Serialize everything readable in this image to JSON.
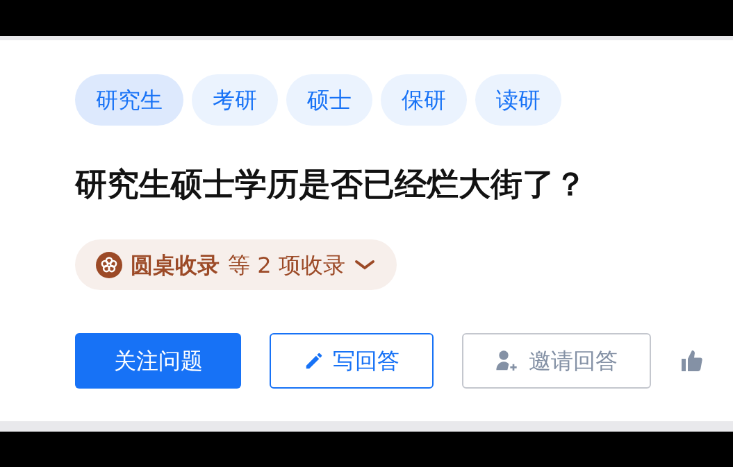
{
  "topics": [
    {
      "label": "研究生",
      "selected": true
    },
    {
      "label": "考研",
      "selected": false
    },
    {
      "label": "硕士",
      "selected": false
    },
    {
      "label": "保研",
      "selected": false
    },
    {
      "label": "读研",
      "selected": false
    }
  ],
  "question": {
    "title": "研究生硕士学历是否已经烂大街了？"
  },
  "collection": {
    "name": "圆桌收录",
    "rest": "等 2 项收录"
  },
  "actions": [
    {
      "kind": "primary",
      "label": "关注问题"
    },
    {
      "kind": "write",
      "label": "写回答"
    },
    {
      "kind": "invite",
      "label": "邀请回答"
    },
    {
      "kind": "like"
    }
  ]
}
